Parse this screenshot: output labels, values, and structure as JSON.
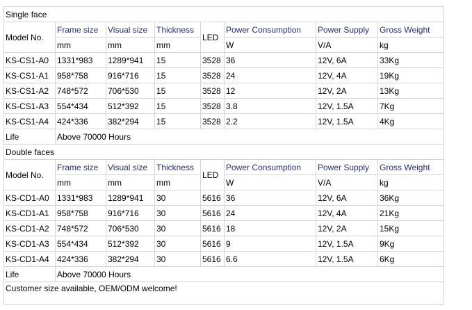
{
  "single": {
    "title": "Single face",
    "headers": {
      "model": "Model No.",
      "frame": "Frame size",
      "visual": "Visual size",
      "thickness": "Thickness",
      "led": "LED",
      "power": "Power Consumption",
      "supply": "Power Supply",
      "weight": "Gross Weight"
    },
    "units": {
      "frame": "mm",
      "visual": "mm",
      "thickness": "mm",
      "power": "W",
      "supply": "V/A",
      "weight": "kg"
    },
    "rows": [
      [
        "KS-CS1-A0",
        "1331*983",
        "1289*941",
        "15",
        "3528",
        "36",
        "12V, 6A",
        "33Kg"
      ],
      [
        "KS-CS1-A1",
        "958*758",
        "916*716",
        "15",
        "3528",
        "24",
        "12V, 4A",
        "19Kg"
      ],
      [
        "KS-CS1-A2",
        "748*572",
        "706*530",
        "15",
        "3528",
        "12",
        "12V, 2A",
        "13Kg"
      ],
      [
        "KS-CS1-A3",
        "554*434",
        "512*392",
        "15",
        "3528",
        "3.8",
        "12V, 1.5A",
        "7Kg"
      ],
      [
        "KS-CS1-A4",
        "424*336",
        "382*294",
        "15",
        "3528",
        "2.2",
        "12V, 1.5A",
        "4Kg"
      ]
    ],
    "life_label": "Life",
    "life_value": "Above 70000 Hours"
  },
  "double": {
    "title": "Double faces",
    "headers": {
      "model": "Model No.",
      "frame": "Frame size",
      "visual": "Visual size",
      "thickness": "Thickness",
      "led": "LED",
      "power": "Power Consumption",
      "supply": "Power Supply",
      "weight": "Gross Weight"
    },
    "units": {
      "frame": "mm",
      "visual": "mm",
      "thickness": "mm",
      "power": "W",
      "supply": "V/A",
      "weight": "kg"
    },
    "rows": [
      [
        "KS-CD1-A0",
        "1331*983",
        "1289*941",
        "30",
        "5616",
        "36",
        "12V, 6A",
        "36Kg"
      ],
      [
        "KS-CD1-A1",
        "958*758",
        "916*716",
        "30",
        "5616",
        "24",
        "12V, 4A",
        "21Kg"
      ],
      [
        "KS-CD1-A2",
        "748*572",
        "706*530",
        "30",
        "5616",
        "18",
        "12V, 2A",
        "15Kg"
      ],
      [
        "KS-CD1-A3",
        "554*434",
        "512*392",
        "30",
        "5616",
        "9",
        "12V, 1.5A",
        "9Kg"
      ],
      [
        "KS-CD1-A4",
        "424*336",
        "382*294",
        "30",
        "5616",
        "6.6",
        "12V, 1.5A",
        "6Kg"
      ]
    ],
    "life_label": "Life",
    "life_value": "Above 70000 Hours"
  },
  "footer_note": "Customer size available, OEM/ODM welcome!",
  "colors": {
    "header_text": "#232e84",
    "body_text": "#000000",
    "border": "#d4d4d4"
  }
}
